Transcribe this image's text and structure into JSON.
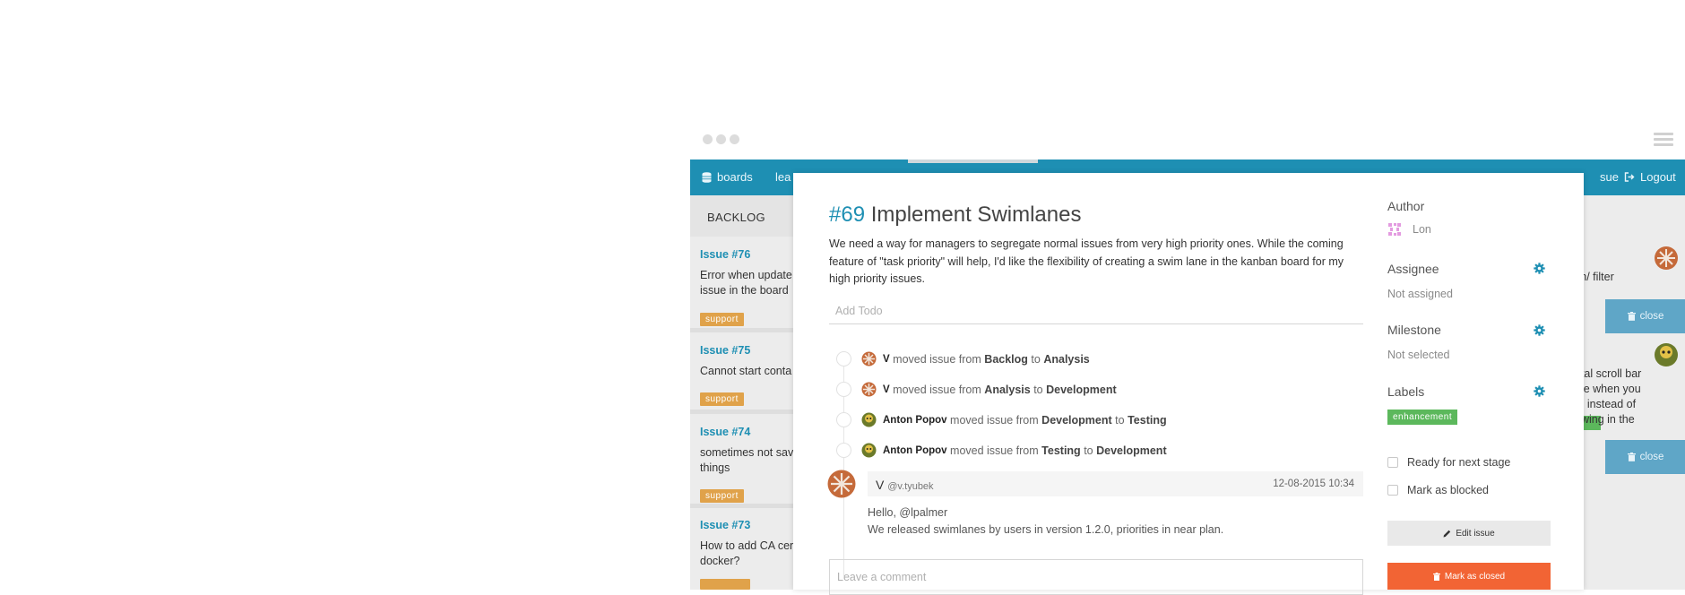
{
  "topbar": {
    "boards_label": "boards",
    "learn_fragment": "lea",
    "issue_fragment": "sue",
    "logout_label": "Logout"
  },
  "board": {
    "column_title": "BACKLOG",
    "cards": [
      {
        "title": "Issue #76",
        "text": [
          "Error when update",
          "issue in the board"
        ],
        "tag": "support"
      },
      {
        "title": "Issue #75",
        "text": [
          "Cannot start conta"
        ],
        "tag": "support"
      },
      {
        "title": "Issue #74",
        "text": [
          "sometimes not sav",
          "things"
        ],
        "tag": "support"
      },
      {
        "title": "Issue #73",
        "text": [
          "How to add CA cer",
          "docker?"
        ],
        "tag": ""
      }
    ],
    "right_fragments": {
      "line1": "ch/ filter",
      "block2": [
        "ntal scroll bar",
        "ble when you",
        "n, instead of",
        "owing in the"
      ],
      "close_label": "close",
      "green_fragment": "nt"
    }
  },
  "issue": {
    "number": "#69",
    "title": "Implement Swimlanes",
    "description": "We need a way for managers to segregate normal issues from very high priority ones. While the coming feature of \"task priority\" will help, I'd like the flexibility of creating a swim lane in the kanban board for my high priority issues.",
    "todo_placeholder": "Add Todo",
    "events": [
      {
        "user": "V",
        "text": "moved issue from",
        "from": "Backlog",
        "to_word": "to",
        "to": "Analysis"
      },
      {
        "user": "V",
        "text": "moved issue from",
        "from": "Analysis",
        "to_word": "to",
        "to": "Development"
      },
      {
        "user": "Anton Popov",
        "text": "moved issue from",
        "from": "Development",
        "to_word": "to",
        "to": "Testing"
      },
      {
        "user": "Anton Popov",
        "text": "moved issue from",
        "from": "Testing",
        "to_word": "to",
        "to": "Development"
      }
    ],
    "comment": {
      "author": "V",
      "handle": "@v.tyubek",
      "date": "12-08-2015 10:34",
      "lines": [
        "Hello, @lpalmer",
        "We released swimlanes by users in version 1.2.0, priorities in near plan."
      ]
    },
    "comment_placeholder": "Leave a comment"
  },
  "sidebar": {
    "author_label": "Author",
    "author_name": "Lon",
    "assignee_label": "Assignee",
    "assignee_value": "Not assigned",
    "milestone_label": "Milestone",
    "milestone_value": "Not selected",
    "labels_label": "Labels",
    "label_badge": "enhancement",
    "ready_label": "Ready for next stage",
    "blocked_label": "Mark as blocked",
    "edit_label": "Edit issue",
    "close_label": "Mark as closed"
  },
  "colors": {
    "topbar": "#1e8fb3",
    "accent": "#1e8fb3",
    "support_tag": "#e0a24a",
    "enhancement_tag": "#5cb85c",
    "close_button": "#f26434"
  }
}
